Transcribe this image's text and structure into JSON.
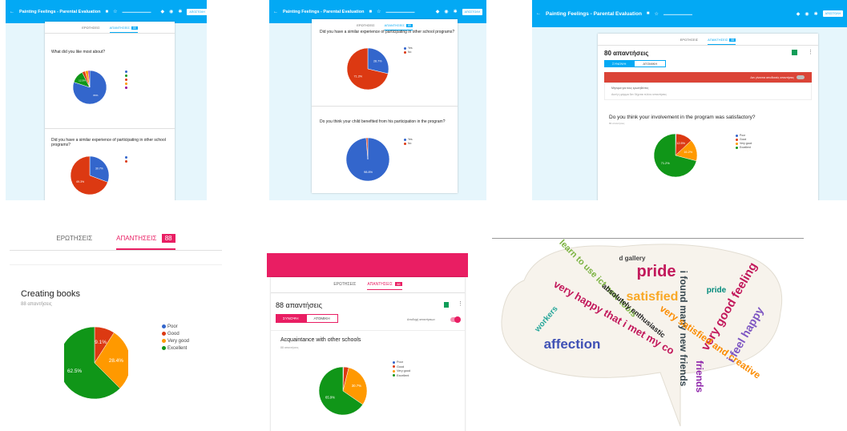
{
  "colors": {
    "blue": "#3366cc",
    "red": "#dc3912",
    "orange": "#ff9900",
    "green": "#109618",
    "accent": "#03a9f4",
    "pink": "#e91e63"
  },
  "header": {
    "title": "Painting Feelings - Parental Evaluation",
    "send": "ΑΠΟΣΤΟΛΗ"
  },
  "tabs": {
    "questions": "ΕΡΩΤΗΣΕΙΣ",
    "responses": "ΑΠΑΝΤΗΣΕΙΣ",
    "count": "88"
  },
  "p3": {
    "responses_count": "80 απαντήσεις",
    "summary_tab": "ΣΥΝΟΨΗ",
    "individual_tab": "ΑΤΟΜΙΚΗ",
    "not_accepting": "Δεν γίνονται αποδεκτές απαντήσεις",
    "closed_msg_label": "Μήνυμα για τους ερωτηθέντες",
    "closed_msg": "Αυτή η φόρμα δεν δέχεται πλέον απαντήσεις"
  },
  "p5": {
    "responses_count": "88 απαντήσεις",
    "summary_tab": "ΣΥΝΟΨΗ",
    "individual_tab": "ΑΤΟΜΙΚΗ",
    "accepting": "Αποδοχή απαντήσεων"
  },
  "chart_data": [
    {
      "type": "pie",
      "title": "What did you like most about?",
      "subtitle": "",
      "categories": [
        "",
        "",
        "",
        "",
        ""
      ],
      "values": [
        80.0,
        12.5,
        3.0,
        3.0,
        1.5
      ],
      "colors": [
        "#3366cc",
        "#109618",
        "#dc3912",
        "#ff9900",
        "#990099"
      ],
      "labels": [
        "80%",
        "12.5%",
        "",
        "",
        ""
      ]
    },
    {
      "type": "pie",
      "title": "Did you have a similar experience of participating in other school programs?",
      "subtitle": "",
      "categories": [
        "",
        ""
      ],
      "values": [
        30.7,
        69.3
      ],
      "colors": [
        "#3366cc",
        "#dc3912"
      ],
      "labels": [
        "30.7%",
        "69.3%"
      ]
    },
    {
      "type": "pie",
      "title": "Did you have a similar experience of participating in other school programs?",
      "categories": [
        "Yes",
        "No"
      ],
      "values": [
        28.7,
        71.3
      ],
      "colors": [
        "#3366cc",
        "#dc3912"
      ],
      "labels": [
        "28.7%",
        "71.3%"
      ]
    },
    {
      "type": "pie",
      "title": "Do you think your child benefited from his participation in the program?",
      "subtitle": "",
      "categories": [
        "Yes",
        "No"
      ],
      "values": [
        98.8,
        1.2
      ],
      "colors": [
        "#3366cc",
        "#dc3912"
      ],
      "labels": [
        "98.8%",
        ""
      ]
    },
    {
      "type": "pie",
      "title": "Do you think your involvement in the program was satisfactory?",
      "subtitle": "80 απαντήσεις",
      "categories": [
        "Poor",
        "Good",
        "Very good",
        "Excellent"
      ],
      "values": [
        0.5,
        12.5,
        16.2,
        71.2
      ],
      "colors": [
        "#3366cc",
        "#dc3912",
        "#ff9900",
        "#109618"
      ],
      "labels": [
        "",
        "12.5%",
        "16.2%",
        "71.2%"
      ]
    },
    {
      "type": "pie",
      "title": "Creating books",
      "subtitle": "88 απαντήσεις",
      "categories": [
        "Poor",
        "Good",
        "Very good",
        "Excellent"
      ],
      "values": [
        0,
        9.1,
        28.4,
        62.5
      ],
      "colors": [
        "#3366cc",
        "#dc3912",
        "#ff9900",
        "#109618"
      ],
      "labels": [
        "",
        "9.1%",
        "28.4%",
        "62.5%"
      ]
    },
    {
      "type": "pie",
      "title": "Acquaintance with other schools",
      "subtitle": "88 απαντήσεις",
      "categories": [
        "Poor",
        "Good",
        "Very good",
        "Excellent"
      ],
      "values": [
        0.5,
        3.4,
        30.7,
        65.4
      ],
      "colors": [
        "#3366cc",
        "#dc3912",
        "#ff9900",
        "#109618"
      ],
      "labels": [
        "",
        "",
        "30.7%",
        "65.9%"
      ]
    }
  ],
  "wordcloud": {
    "words": [
      {
        "text": "pride",
        "size": 20,
        "color": "#c2185b",
        "rot": 0
      },
      {
        "text": "affection",
        "size": 17,
        "color": "#3f51b5",
        "rot": 0
      },
      {
        "text": "satisfied",
        "size": 16,
        "color": "#f9a825",
        "rot": 0
      },
      {
        "text": "very good feeling",
        "size": 15,
        "color": "#c2185b",
        "rot": -60
      },
      {
        "text": "i found many new friends",
        "size": 12,
        "color": "#37474f",
        "rot": 90
      },
      {
        "text": "very happy that i met my co",
        "size": 13,
        "color": "#c2185b",
        "rot": 30
      },
      {
        "text": "learn to use ict new tools",
        "size": 11,
        "color": "#7cb342",
        "rot": 45
      },
      {
        "text": "very satisfied and creative",
        "size": 12,
        "color": "#fb8c00",
        "rot": 35
      },
      {
        "text": "absolutely enthusiastic",
        "size": 9,
        "color": "#212121",
        "rot": 40
      },
      {
        "text": "i feel happy",
        "size": 14,
        "color": "#7e57c2",
        "rot": -60
      },
      {
        "text": "workers",
        "size": 10,
        "color": "#26a69a",
        "rot": -50
      },
      {
        "text": "d gallery",
        "size": 8,
        "color": "#424242",
        "rot": 0
      },
      {
        "text": "friends",
        "size": 12,
        "color": "#8e24aa",
        "rot": 90
      },
      {
        "text": "pride",
        "size": 10,
        "color": "#00897b",
        "rot": 0
      }
    ]
  }
}
